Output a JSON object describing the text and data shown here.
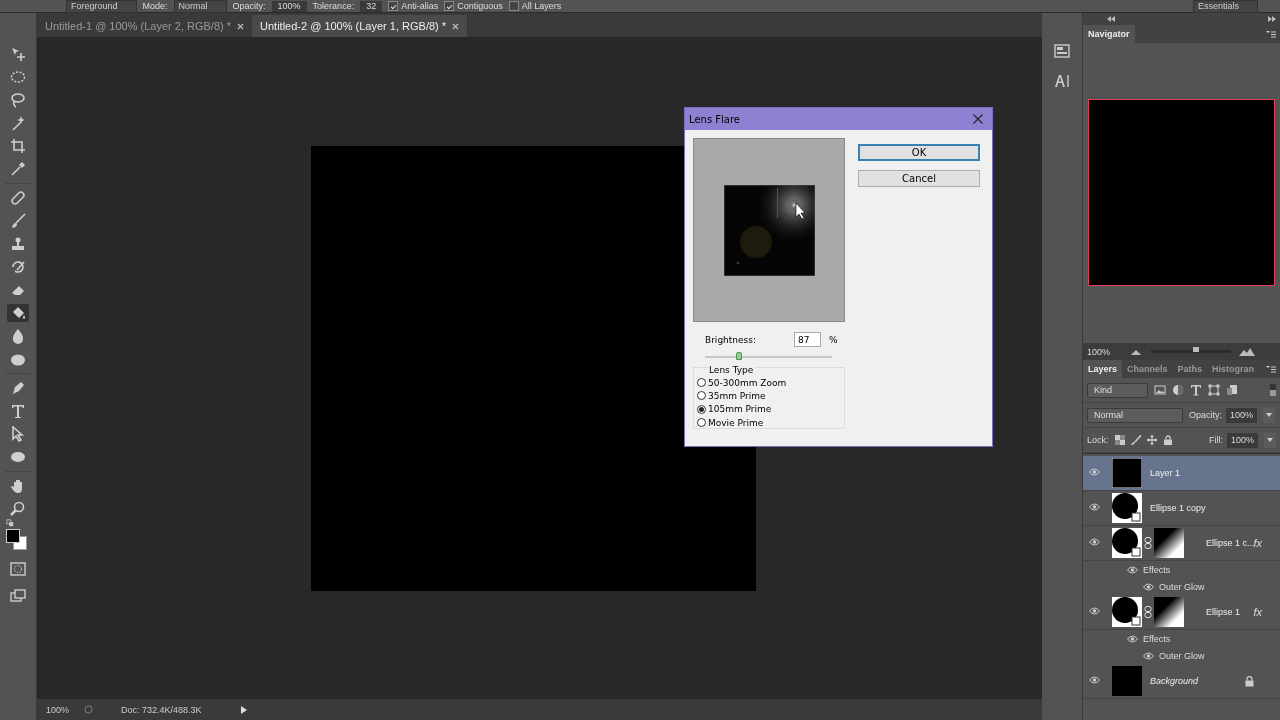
{
  "options_bar": {
    "preset": "Foreground",
    "mode_label": "Mode:",
    "mode": "Normal",
    "opacity_label": "Opacity:",
    "opacity": "100%",
    "tolerance_label": "Tolerance:",
    "tolerance": "32",
    "checks": [
      {
        "label": "Anti-alias",
        "checked": true
      },
      {
        "label": "Contiguous",
        "checked": true
      },
      {
        "label": "All Layers",
        "checked": false
      }
    ],
    "workspace": "Essentials"
  },
  "tools": [
    {
      "kind": "move",
      "selected": false
    },
    {
      "kind": "marquee",
      "selected": false
    },
    {
      "kind": "lasso",
      "selected": false
    },
    {
      "kind": "wand",
      "selected": false
    },
    {
      "kind": "crop",
      "selected": false
    },
    {
      "kind": "eyedropper",
      "selected": false
    },
    {
      "kind": "healing",
      "selected": false
    },
    {
      "kind": "brush",
      "selected": false
    },
    {
      "kind": "stamp",
      "selected": false
    },
    {
      "kind": "history",
      "selected": false
    },
    {
      "kind": "eraser",
      "selected": false
    },
    {
      "kind": "bucket",
      "selected": true
    },
    {
      "kind": "blur",
      "selected": false
    },
    {
      "kind": "sponge",
      "selected": false
    },
    {
      "kind": "pen",
      "selected": false
    },
    {
      "kind": "type",
      "selected": false
    },
    {
      "kind": "select",
      "selected": false
    },
    {
      "kind": "shape",
      "selected": false
    },
    {
      "kind": "hand",
      "selected": false
    },
    {
      "kind": "zoom",
      "selected": false
    }
  ],
  "document_tabs": [
    {
      "label": "Untitled-1 @ 100% (Layer 2, RGB/8) *",
      "selected": false
    },
    {
      "label": "Untitled-2 @ 100% (Layer 1, RGB/8) *",
      "selected": true
    }
  ],
  "status_bar": {
    "zoom": "100%",
    "doc_info": "Doc: 732.4K/488.3K"
  },
  "dialog": {
    "title": "Lens Flare",
    "buttons": [
      {
        "label": "OK",
        "selected": true
      },
      {
        "label": "Cancel",
        "selected": false
      }
    ],
    "brightness_label": "Brightness:",
    "brightness": "87",
    "unit": "%",
    "slider": {
      "level": 0.27
    },
    "group_label": "Lens Type",
    "lens_types": [
      {
        "label": "50-300mm Zoom",
        "selected": false
      },
      {
        "label": "35mm Prime",
        "selected": false
      },
      {
        "label": "105mm Prime",
        "selected": true
      },
      {
        "label": "Movie Prime",
        "selected": false
      }
    ]
  },
  "navigator": {
    "tab": "Navigator",
    "zoom": "100%",
    "slider": {
      "level": 0.56
    }
  },
  "layers_panel": {
    "tabs": [
      {
        "label": "Layers",
        "selected": true
      },
      {
        "label": "Channels",
        "selected": false
      },
      {
        "label": "Paths",
        "selected": false
      },
      {
        "label": "Histogran",
        "selected": false
      }
    ],
    "filter": "Kind",
    "blend_mode": "Normal",
    "opacity_label": "Opacity:",
    "opacity": "100%",
    "lock_label": "Lock:",
    "fill_label": "Fill:",
    "fill": "100%",
    "layers": [
      {
        "name": "Layer 1",
        "kind": "pixel",
        "selected": true,
        "visible": true
      },
      {
        "name": "Ellipse 1 copy",
        "kind": "shape",
        "selected": false,
        "visible": true
      },
      {
        "name": "Ellipse 1 c...",
        "kind": "shape",
        "mask": true,
        "fx": "fx",
        "selected": false,
        "visible": true,
        "children": [
          {
            "name": "Effects",
            "visible": true,
            "children": [
              {
                "name": "Outer Glow",
                "visible": true
              }
            ]
          }
        ]
      },
      {
        "name": "Ellipse 1",
        "kind": "shape",
        "mask": true,
        "fx": "fx",
        "selected": false,
        "visible": true,
        "children": [
          {
            "name": "Effects",
            "visible": true,
            "children": [
              {
                "name": "Outer Glow",
                "visible": true
              }
            ]
          }
        ]
      },
      {
        "name": "Background",
        "kind": "background",
        "locked": true,
        "selected": false,
        "visible": true
      }
    ]
  }
}
